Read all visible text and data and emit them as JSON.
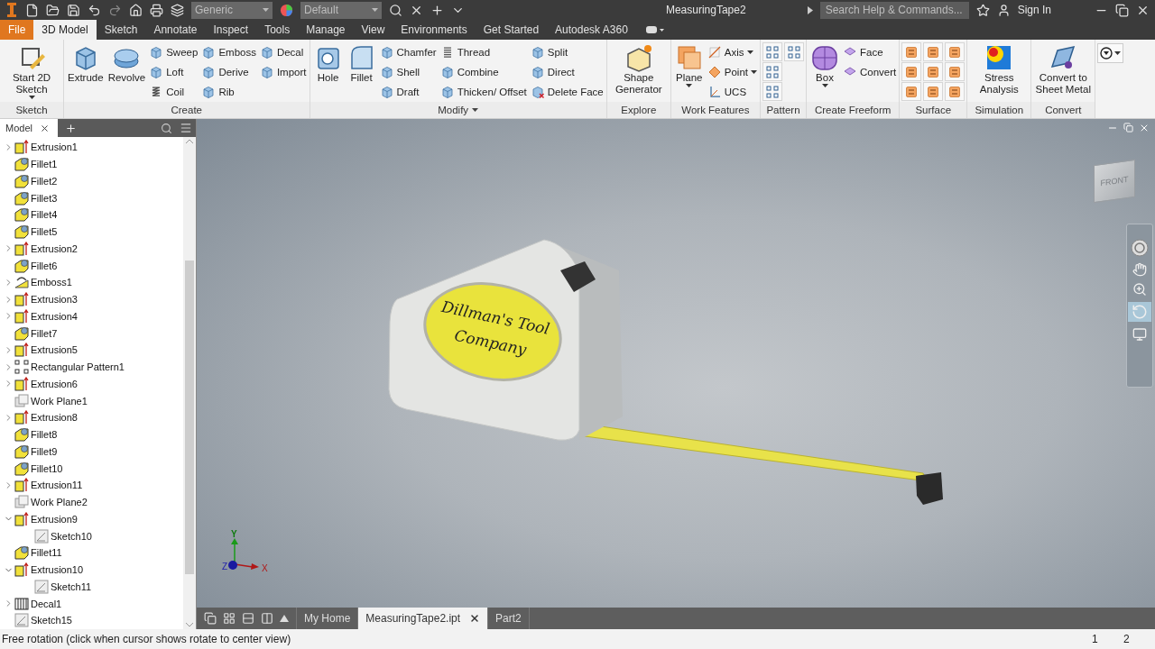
{
  "title_bar": {
    "material": "Generic",
    "appearance": "Default",
    "title": "MeasuringTape2",
    "search": {
      "placeholder": "Search Help & Commands..."
    },
    "sign_in": "Sign In"
  },
  "ribbon_tabs": [
    {
      "label": "File",
      "kind": "file",
      "selected": false
    },
    {
      "label": "3D Model",
      "kind": "tab",
      "selected": true
    },
    {
      "label": "Sketch",
      "kind": "tab",
      "selected": false
    },
    {
      "label": "Annotate",
      "kind": "tab",
      "selected": false
    },
    {
      "label": "Inspect",
      "kind": "tab",
      "selected": false
    },
    {
      "label": "Tools",
      "kind": "tab",
      "selected": false
    },
    {
      "label": "Manage",
      "kind": "tab",
      "selected": false
    },
    {
      "label": "View",
      "kind": "tab",
      "selected": false
    },
    {
      "label": "Environments",
      "kind": "tab",
      "selected": false
    },
    {
      "label": "Get Started",
      "kind": "tab",
      "selected": false
    },
    {
      "label": "Autodesk A360",
      "kind": "tab",
      "selected": false
    }
  ],
  "ribbon_panels": [
    {
      "label": "Sketch",
      "menu": false,
      "tools": [
        {
          "label": "Start 2D Sketch",
          "kind": "large",
          "caret": true
        }
      ]
    },
    {
      "label": "Create",
      "menu": false,
      "tools": [
        {
          "label": "Extrude",
          "kind": "large",
          "caret": false
        },
        {
          "label": "Revolve",
          "kind": "large",
          "caret": false
        },
        {
          "label": "Sweep",
          "kind": "small",
          "caret": false
        },
        {
          "label": "Loft",
          "kind": "small",
          "caret": false
        },
        {
          "label": "Coil",
          "kind": "small",
          "caret": false
        },
        {
          "label": "Emboss",
          "kind": "small",
          "caret": false
        },
        {
          "label": "Derive",
          "kind": "small",
          "caret": false
        },
        {
          "label": "Rib",
          "kind": "small",
          "caret": false
        },
        {
          "label": "Decal",
          "kind": "small",
          "caret": false
        },
        {
          "label": "Import",
          "kind": "small",
          "caret": false
        }
      ]
    },
    {
      "label": "Modify",
      "menu": true,
      "tools": [
        {
          "label": "Hole",
          "kind": "large",
          "caret": false
        },
        {
          "label": "Fillet",
          "kind": "large",
          "caret": false
        },
        {
          "label": "Chamfer",
          "kind": "small",
          "caret": false
        },
        {
          "label": "Shell",
          "kind": "small",
          "caret": false
        },
        {
          "label": "Draft",
          "kind": "small",
          "caret": false
        },
        {
          "label": "Thread",
          "kind": "small",
          "caret": false
        },
        {
          "label": "Combine",
          "kind": "small",
          "caret": false
        },
        {
          "label": "Thicken/ Offset",
          "kind": "small",
          "caret": false
        },
        {
          "label": "Split",
          "kind": "small",
          "caret": false
        },
        {
          "label": "Direct",
          "kind": "small",
          "caret": false
        },
        {
          "label": "Delete Face",
          "kind": "small",
          "caret": false
        }
      ]
    },
    {
      "label": "Explore",
      "menu": false,
      "tools": [
        {
          "label": "Shape Generator",
          "kind": "large",
          "caret": false
        }
      ]
    },
    {
      "label": "Work Features",
      "menu": false,
      "tools": [
        {
          "label": "Plane",
          "kind": "large",
          "caret": true
        },
        {
          "label": "Axis",
          "kind": "small",
          "caret": true
        },
        {
          "label": "Point",
          "kind": "small",
          "caret": true
        },
        {
          "label": "UCS",
          "kind": "small",
          "caret": false
        }
      ]
    },
    {
      "label": "Pattern",
      "menu": false,
      "tools": [
        {
          "kind": "icon",
          "caret": false
        },
        {
          "kind": "icon",
          "caret": false
        },
        {
          "kind": "icon",
          "caret": false
        },
        {
          "kind": "icon",
          "caret": false
        }
      ]
    },
    {
      "label": "Create Freeform",
      "menu": false,
      "tools": [
        {
          "label": "Box",
          "kind": "large",
          "caret": true
        },
        {
          "label": "Face",
          "kind": "small",
          "caret": false
        },
        {
          "label": "Convert",
          "kind": "small",
          "caret": false
        }
      ]
    },
    {
      "label": "Surface",
      "menu": false,
      "tools": [
        {
          "kind": "icon",
          "caret": false
        },
        {
          "kind": "icon",
          "caret": false
        },
        {
          "kind": "icon",
          "caret": false
        },
        {
          "kind": "icon",
          "caret": false
        },
        {
          "kind": "icon",
          "caret": false
        },
        {
          "kind": "icon",
          "caret": false
        },
        {
          "kind": "icon",
          "caret": false
        },
        {
          "kind": "icon",
          "caret": false
        },
        {
          "kind": "icon",
          "caret": false
        }
      ]
    },
    {
      "label": "Simulation",
      "menu": false,
      "tools": [
        {
          "label": "Stress Analysis",
          "kind": "large",
          "caret": false
        }
      ]
    },
    {
      "label": "Convert",
      "menu": false,
      "tools": [
        {
          "label": "Convert to Sheet Metal",
          "kind": "large",
          "caret": false
        }
      ]
    }
  ],
  "browser": {
    "tab": "Model",
    "tree": [
      {
        "label": "Extrusion1",
        "kind": "extrusion",
        "expandable": true,
        "expanded": false
      },
      {
        "label": "Fillet1",
        "kind": "fillet",
        "expandable": false,
        "expanded": false
      },
      {
        "label": "Fillet2",
        "kind": "fillet",
        "expandable": false,
        "expanded": false
      },
      {
        "label": "Fillet3",
        "kind": "fillet",
        "expandable": false,
        "expanded": false
      },
      {
        "label": "Fillet4",
        "kind": "fillet",
        "expandable": false,
        "expanded": false
      },
      {
        "label": "Fillet5",
        "kind": "fillet",
        "expandable": false,
        "expanded": false
      },
      {
        "label": "Extrusion2",
        "kind": "extrusion",
        "expandable": true,
        "expanded": false
      },
      {
        "label": "Fillet6",
        "kind": "fillet",
        "expandable": false,
        "expanded": false
      },
      {
        "label": "Emboss1",
        "kind": "emboss",
        "expandable": true,
        "expanded": false
      },
      {
        "label": "Extrusion3",
        "kind": "extrusion",
        "expandable": true,
        "expanded": false
      },
      {
        "label": "Extrusion4",
        "kind": "extrusion",
        "expandable": true,
        "expanded": false
      },
      {
        "label": "Fillet7",
        "kind": "fillet",
        "expandable": false,
        "expanded": false
      },
      {
        "label": "Extrusion5",
        "kind": "extrusion",
        "expandable": true,
        "expanded": false
      },
      {
        "label": "Rectangular Pattern1",
        "kind": "pattern",
        "expandable": true,
        "expanded": false
      },
      {
        "label": "Extrusion6",
        "kind": "extrusion",
        "expandable": true,
        "expanded": false
      },
      {
        "label": "Work Plane1",
        "kind": "work_plane",
        "expandable": false,
        "expanded": false
      },
      {
        "label": "Extrusion8",
        "kind": "extrusion",
        "expandable": true,
        "expanded": false
      },
      {
        "label": "Fillet8",
        "kind": "fillet",
        "expandable": false,
        "expanded": false
      },
      {
        "label": "Fillet9",
        "kind": "fillet",
        "expandable": false,
        "expanded": false
      },
      {
        "label": "Fillet10",
        "kind": "fillet",
        "expandable": false,
        "expanded": false
      },
      {
        "label": "Extrusion11",
        "kind": "extrusion",
        "expandable": true,
        "expanded": false
      },
      {
        "label": "Work Plane2",
        "kind": "work_plane",
        "expandable": false,
        "expanded": false
      },
      {
        "label": "Extrusion9",
        "kind": "extrusion",
        "expandable": true,
        "expanded": true,
        "children": [
          {
            "label": "Sketch10",
            "kind": "sketch",
            "expandable": false,
            "expanded": false
          }
        ]
      },
      {
        "label": "Fillet11",
        "kind": "fillet",
        "expandable": false,
        "expanded": false
      },
      {
        "label": "Extrusion10",
        "kind": "extrusion",
        "expandable": true,
        "expanded": true,
        "children": [
          {
            "label": "Sketch11",
            "kind": "sketch",
            "expandable": false,
            "expanded": false
          }
        ]
      },
      {
        "label": "Decal1",
        "kind": "decal",
        "expandable": true,
        "expanded": false
      },
      {
        "label": "Sketch15",
        "kind": "sketch",
        "expandable": false,
        "expanded": false
      }
    ]
  },
  "viewport": {
    "decal_lines": [
      "Dillman's Tool",
      "Company"
    ],
    "view_cube": "FRONT",
    "axes": {
      "x": "X",
      "y": "Y",
      "z": "Z"
    }
  },
  "document_tabs": [
    {
      "label": "My Home",
      "selected": false,
      "closable": false
    },
    {
      "label": "MeasuringTape2.ipt",
      "selected": true,
      "closable": true
    },
    {
      "label": "Part2",
      "selected": false,
      "closable": false
    }
  ],
  "status_bar": {
    "message": "Free rotation (click when cursor shows rotate to center view)",
    "counts": [
      "1",
      "2"
    ]
  }
}
